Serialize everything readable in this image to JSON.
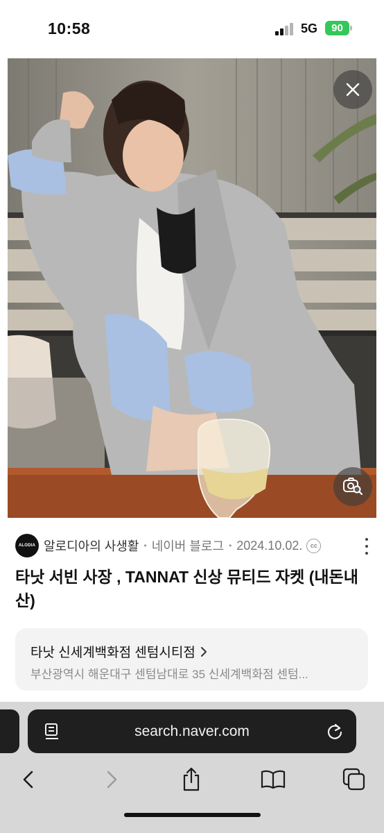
{
  "status_bar": {
    "time": "10:58",
    "network": "5G",
    "battery": "90"
  },
  "photo": {
    "close_icon": "close-icon",
    "lens_icon": "image-search-icon"
  },
  "result": {
    "source_avatar_text": "ALODIA",
    "source_name": "알로디아의 사생활",
    "source_site": "네이버 블로그",
    "date": "2024.10.02.",
    "cc_text": "cc",
    "title": "타낫 서빈 사장 , TANNAT 신상 뮤티드 자켓 (내돈내산)"
  },
  "place": {
    "title": "타낫 신세계백화점 센텀시티점",
    "address": "부산광역시 해운대구 센텀남대로 35 신세계백화점 센텀..."
  },
  "browser": {
    "url": "search.naver.com"
  },
  "colors": {
    "battery": "#34c759",
    "toolbar_bg": "#d7d7d7",
    "address_bar_bg": "#1f1f1f"
  }
}
